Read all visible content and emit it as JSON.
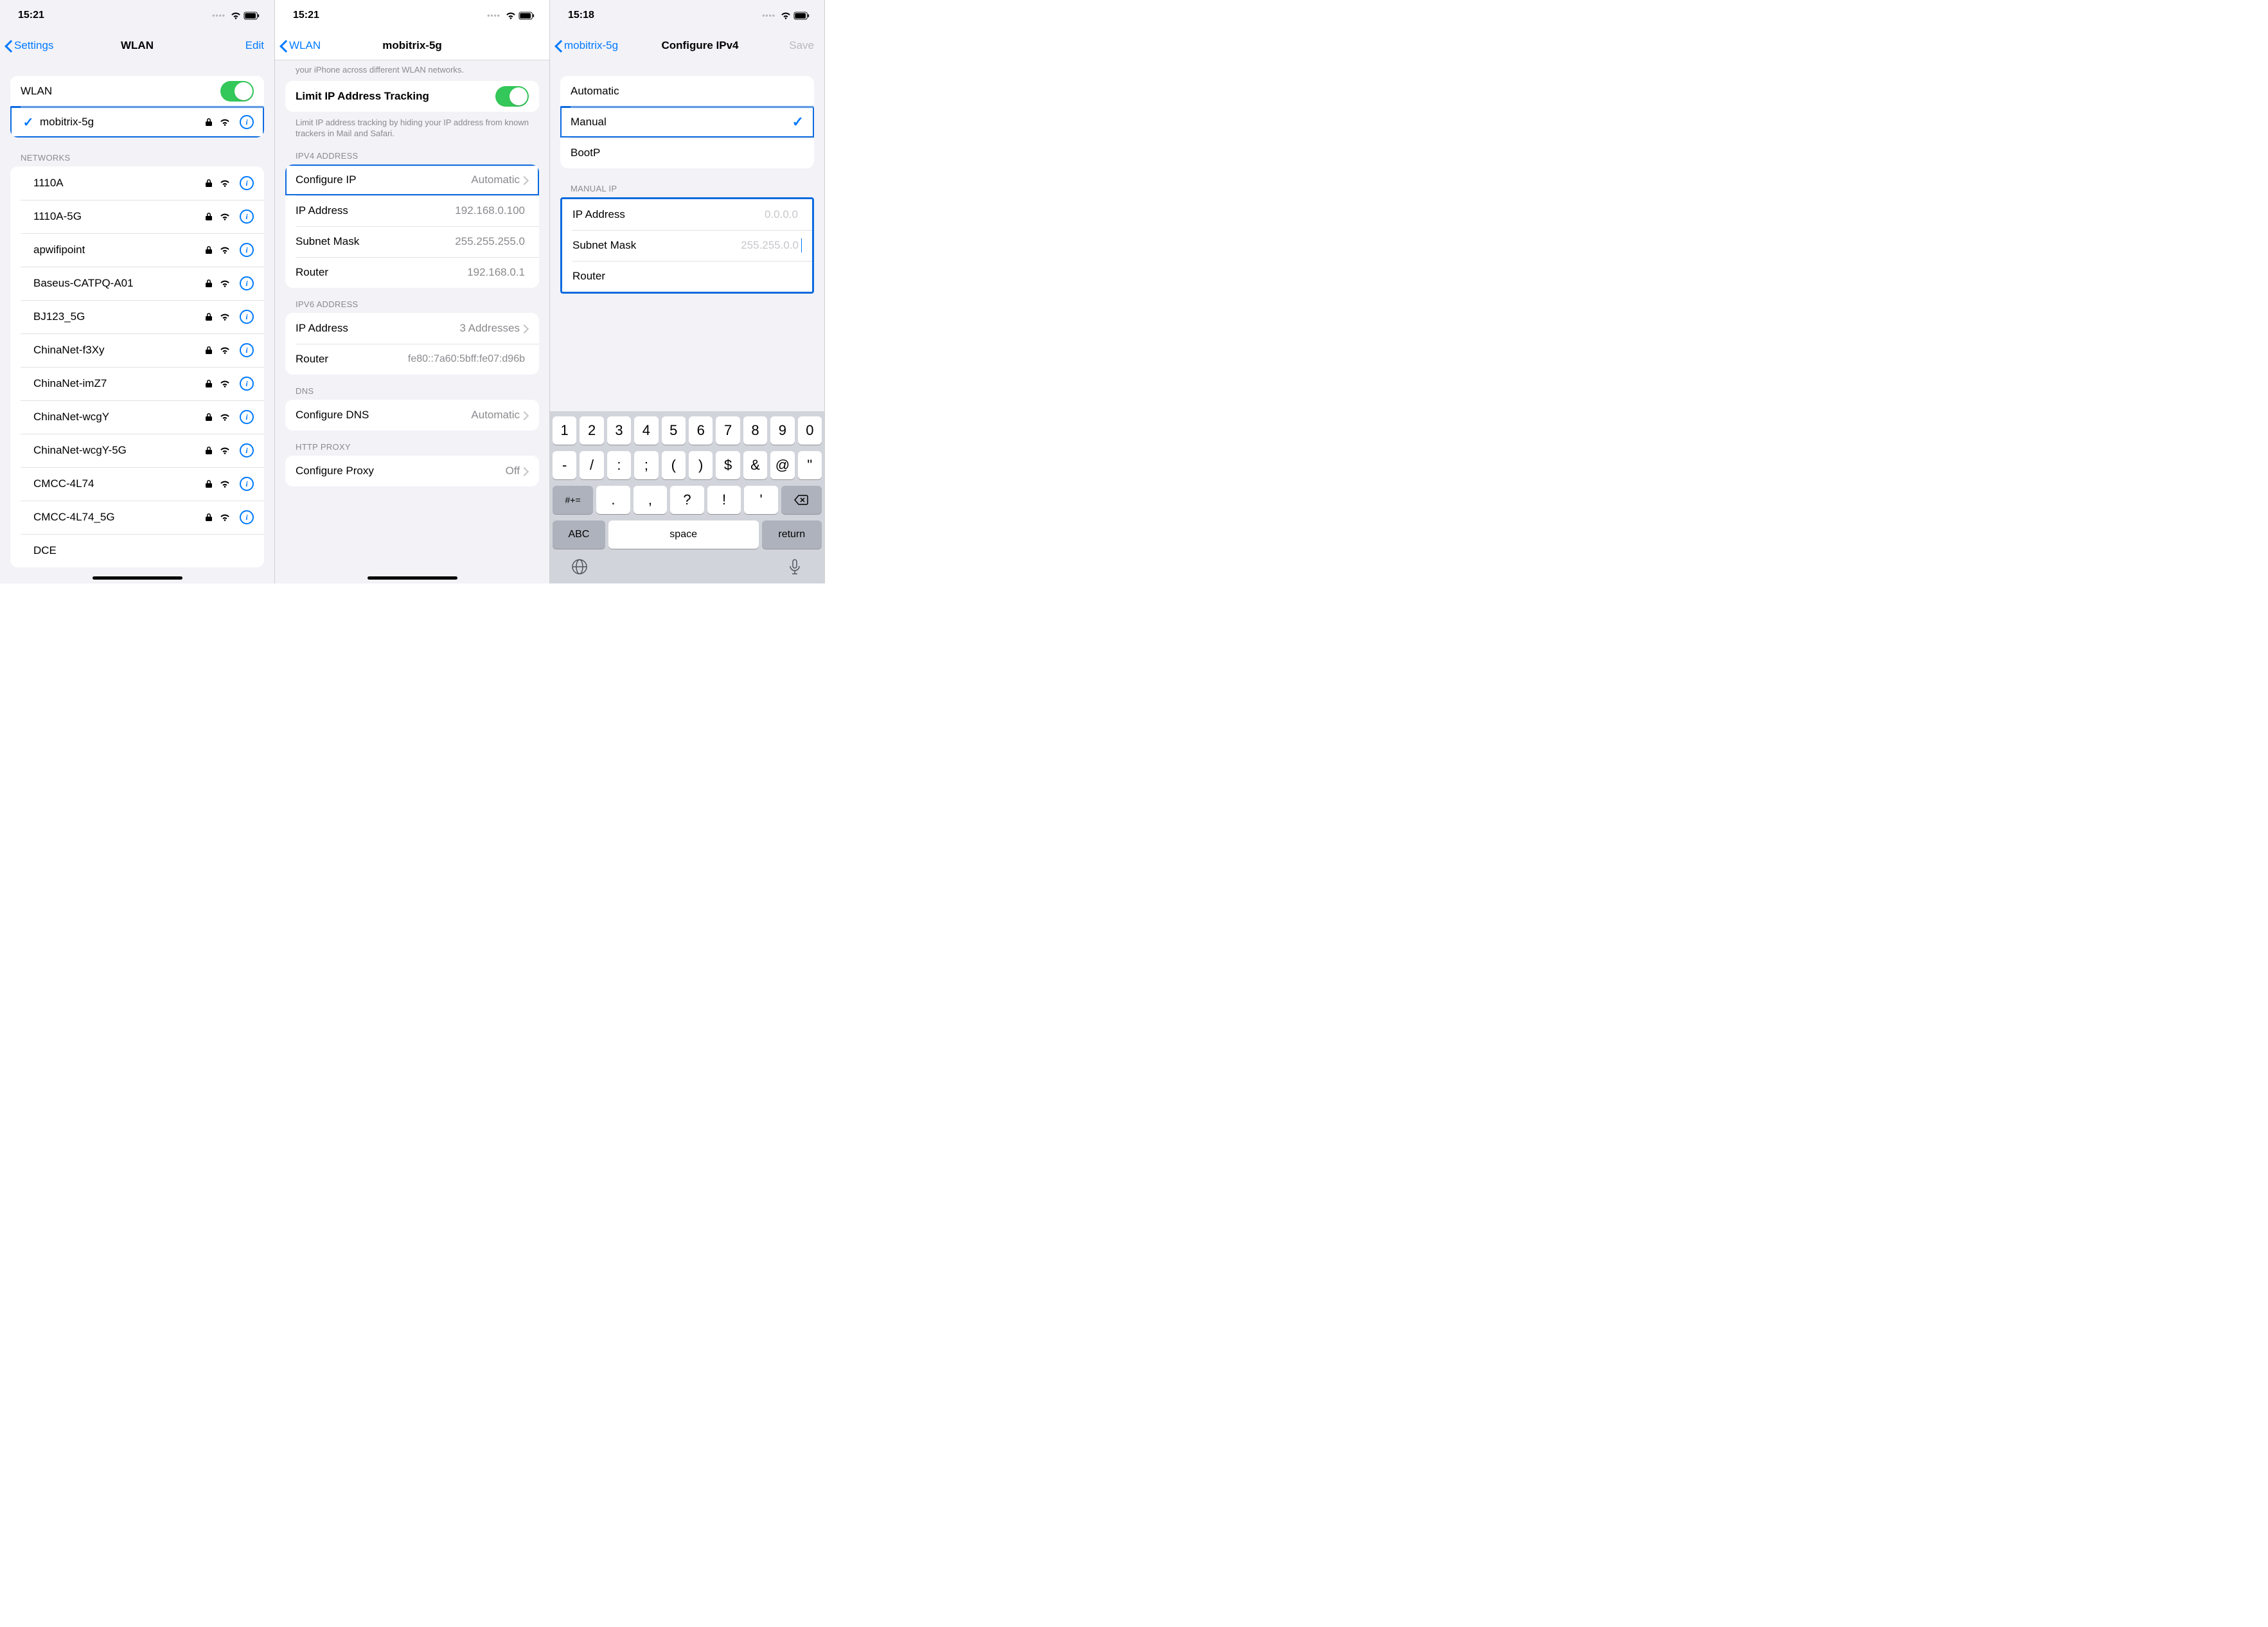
{
  "screen1": {
    "status_time": "15:21",
    "nav_back": "Settings",
    "nav_title": "WLAN",
    "nav_right": "Edit",
    "wlan_toggle_label": "WLAN",
    "connected_network": "mobitrix-5g",
    "networks_header": "NETWORKS",
    "networks": [
      "1110A",
      "1110A-5G",
      "apwifipoint",
      "Baseus-CATPQ-A01",
      "BJ123_5G",
      "ChinaNet-f3Xy",
      "ChinaNet-imZ7",
      "ChinaNet-wcgY",
      "ChinaNet-wcgY-5G",
      "CMCC-4L74",
      "CMCC-4L74_5G"
    ],
    "partial_network": "DCE"
  },
  "screen2": {
    "status_time": "15:21",
    "nav_back": "WLAN",
    "nav_title": "mobitrix-5g",
    "truncated_hint": "your iPhone across different WLAN networks.",
    "limit_label": "Limit IP Address Tracking",
    "limit_footer": "Limit IP address tracking by hiding your IP address from known trackers in Mail and Safari.",
    "ipv4_header": "IPV4 ADDRESS",
    "configure_ip_label": "Configure IP",
    "configure_ip_value": "Automatic",
    "ip_address_label": "IP Address",
    "ip_address_value": "192.168.0.100",
    "subnet_label": "Subnet Mask",
    "subnet_value": "255.255.255.0",
    "router_label": "Router",
    "router_value": "192.168.0.1",
    "ipv6_header": "IPV6 ADDRESS",
    "ipv6_ip_label": "IP Address",
    "ipv6_ip_value": "3 Addresses",
    "ipv6_router_label": "Router",
    "ipv6_router_value": "fe80::7a60:5bff:fe07:d96b",
    "dns_header": "DNS",
    "dns_label": "Configure DNS",
    "dns_value": "Automatic",
    "proxy_header": "HTTP PROXY",
    "proxy_label": "Configure Proxy",
    "proxy_value": "Off"
  },
  "screen3": {
    "status_time": "15:18",
    "nav_back": "mobitrix-5g",
    "nav_title": "Configure IPv4",
    "nav_right": "Save",
    "option_auto": "Automatic",
    "option_manual": "Manual",
    "option_bootp": "BootP",
    "manual_header": "MANUAL IP",
    "ip_label": "IP Address",
    "ip_placeholder": "0.0.0.0",
    "subnet_label": "Subnet Mask",
    "subnet_value": "255.255.0.0",
    "router_label": "Router",
    "keyboard": {
      "row1": [
        "1",
        "2",
        "3",
        "4",
        "5",
        "6",
        "7",
        "8",
        "9",
        "0"
      ],
      "row2": [
        "-",
        "/",
        ":",
        ";",
        "(",
        ")",
        "$",
        "&",
        "@",
        "\""
      ],
      "row3_shift": "#+=",
      "row3": [
        ".",
        ",",
        "?",
        "!",
        "'"
      ],
      "abc": "ABC",
      "space": "space",
      "return": "return"
    }
  }
}
